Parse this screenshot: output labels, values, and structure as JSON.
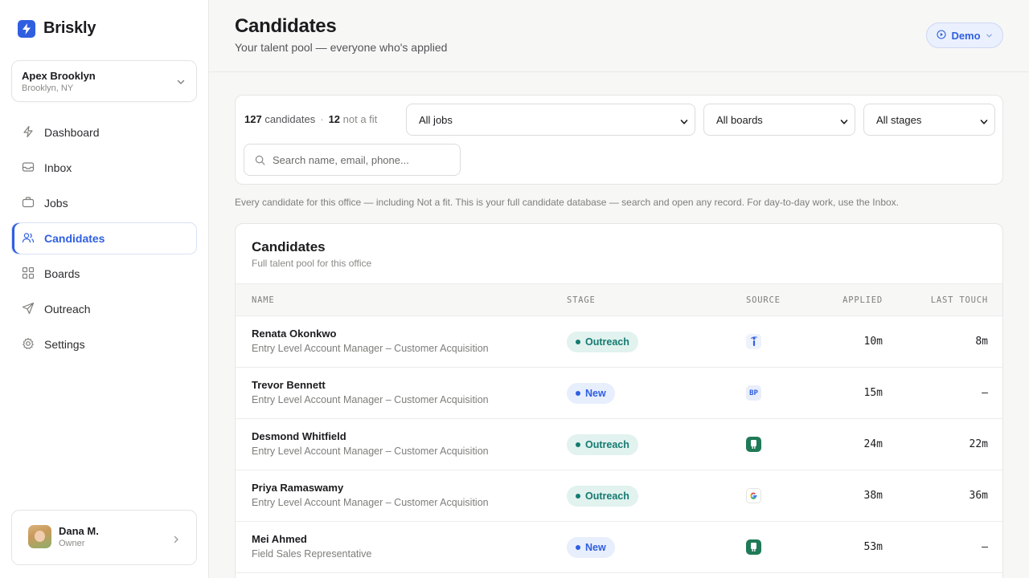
{
  "brand": {
    "name": "Briskly"
  },
  "office": {
    "name": "Apex Brooklyn",
    "location": "Brooklyn, NY"
  },
  "nav": {
    "items": [
      {
        "label": "Dashboard",
        "icon": "bolt-icon"
      },
      {
        "label": "Inbox",
        "icon": "inbox-icon"
      },
      {
        "label": "Jobs",
        "icon": "briefcase-icon"
      },
      {
        "label": "Candidates",
        "icon": "users-icon",
        "active": true
      },
      {
        "label": "Boards",
        "icon": "grid-icon"
      },
      {
        "label": "Outreach",
        "icon": "send-icon"
      },
      {
        "label": "Settings",
        "icon": "gear-icon"
      }
    ]
  },
  "user": {
    "name": "Dana M.",
    "role": "Owner"
  },
  "header": {
    "title": "Candidates",
    "subtitle": "Your talent pool — everyone who's applied",
    "demo_label": "Demo"
  },
  "filters": {
    "candidate_count": "127",
    "candidate_label": "candidates",
    "separator": "·",
    "not_fit_count": "12",
    "not_fit_label": "not a fit",
    "jobs_select": "All jobs",
    "boards_select": "All boards",
    "stages_select": "All stages",
    "search_placeholder": "Search name, email, phone..."
  },
  "helper_text": "Every candidate for this office — including Not a fit. This is your full candidate database — search and open any record. For day-to-day work, use the Inbox.",
  "table": {
    "title": "Candidates",
    "subtitle": "Full talent pool for this office",
    "columns": {
      "name": "NAME",
      "stage": "STAGE",
      "source": "SOURCE",
      "applied": "APPLIED",
      "last_touch": "LAST TOUCH"
    },
    "rows": [
      {
        "name": "Renata Okonkwo",
        "job": "Entry Level Account Manager – Customer Acquisition",
        "stage": "Outreach",
        "source": "indeed-icon",
        "applied": "10m",
        "last_touch": "8m"
      },
      {
        "name": "Trevor Bennett",
        "job": "Entry Level Account Manager – Customer Acquisition",
        "stage": "New",
        "source": "BP",
        "applied": "15m",
        "last_touch": "–"
      },
      {
        "name": "Desmond Whitfield",
        "job": "Entry Level Account Manager – Customer Acquisition",
        "stage": "Outreach",
        "source": "glassdoor-icon",
        "applied": "24m",
        "last_touch": "22m"
      },
      {
        "name": "Priya Ramaswamy",
        "job": "Entry Level Account Manager – Customer Acquisition",
        "stage": "Outreach",
        "source": "google-icon",
        "applied": "38m",
        "last_touch": "36m"
      },
      {
        "name": "Mei Ahmed",
        "job": "Field Sales Representative",
        "stage": "New",
        "source": "glassdoor-icon",
        "applied": "53m",
        "last_touch": "–"
      }
    ]
  },
  "colors": {
    "accent": "#2f5fe0",
    "outreach": "#157a70",
    "outreach_bg": "#e1f2ef",
    "new_bg": "#e7eefc"
  }
}
